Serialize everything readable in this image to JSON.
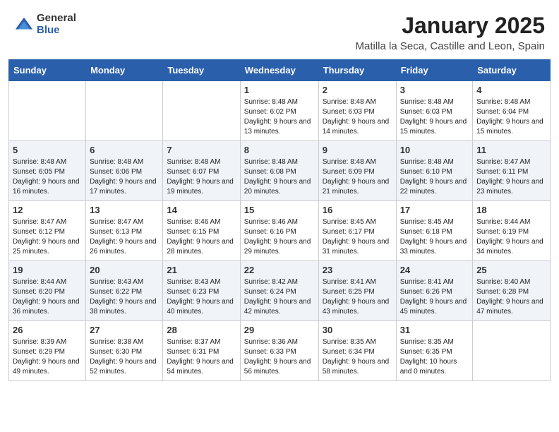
{
  "logo": {
    "general": "General",
    "blue": "Blue"
  },
  "title": "January 2025",
  "subtitle": "Matilla la Seca, Castille and Leon, Spain",
  "weekdays": [
    "Sunday",
    "Monday",
    "Tuesday",
    "Wednesday",
    "Thursday",
    "Friday",
    "Saturday"
  ],
  "weeks": [
    [
      {
        "day": "",
        "info": ""
      },
      {
        "day": "",
        "info": ""
      },
      {
        "day": "",
        "info": ""
      },
      {
        "day": "1",
        "info": "Sunrise: 8:48 AM\nSunset: 6:02 PM\nDaylight: 9 hours and 13 minutes."
      },
      {
        "day": "2",
        "info": "Sunrise: 8:48 AM\nSunset: 6:03 PM\nDaylight: 9 hours and 14 minutes."
      },
      {
        "day": "3",
        "info": "Sunrise: 8:48 AM\nSunset: 6:03 PM\nDaylight: 9 hours and 15 minutes."
      },
      {
        "day": "4",
        "info": "Sunrise: 8:48 AM\nSunset: 6:04 PM\nDaylight: 9 hours and 15 minutes."
      }
    ],
    [
      {
        "day": "5",
        "info": "Sunrise: 8:48 AM\nSunset: 6:05 PM\nDaylight: 9 hours and 16 minutes."
      },
      {
        "day": "6",
        "info": "Sunrise: 8:48 AM\nSunset: 6:06 PM\nDaylight: 9 hours and 17 minutes."
      },
      {
        "day": "7",
        "info": "Sunrise: 8:48 AM\nSunset: 6:07 PM\nDaylight: 9 hours and 19 minutes."
      },
      {
        "day": "8",
        "info": "Sunrise: 8:48 AM\nSunset: 6:08 PM\nDaylight: 9 hours and 20 minutes."
      },
      {
        "day": "9",
        "info": "Sunrise: 8:48 AM\nSunset: 6:09 PM\nDaylight: 9 hours and 21 minutes."
      },
      {
        "day": "10",
        "info": "Sunrise: 8:48 AM\nSunset: 6:10 PM\nDaylight: 9 hours and 22 minutes."
      },
      {
        "day": "11",
        "info": "Sunrise: 8:47 AM\nSunset: 6:11 PM\nDaylight: 9 hours and 23 minutes."
      }
    ],
    [
      {
        "day": "12",
        "info": "Sunrise: 8:47 AM\nSunset: 6:12 PM\nDaylight: 9 hours and 25 minutes."
      },
      {
        "day": "13",
        "info": "Sunrise: 8:47 AM\nSunset: 6:13 PM\nDaylight: 9 hours and 26 minutes."
      },
      {
        "day": "14",
        "info": "Sunrise: 8:46 AM\nSunset: 6:15 PM\nDaylight: 9 hours and 28 minutes."
      },
      {
        "day": "15",
        "info": "Sunrise: 8:46 AM\nSunset: 6:16 PM\nDaylight: 9 hours and 29 minutes."
      },
      {
        "day": "16",
        "info": "Sunrise: 8:45 AM\nSunset: 6:17 PM\nDaylight: 9 hours and 31 minutes."
      },
      {
        "day": "17",
        "info": "Sunrise: 8:45 AM\nSunset: 6:18 PM\nDaylight: 9 hours and 33 minutes."
      },
      {
        "day": "18",
        "info": "Sunrise: 8:44 AM\nSunset: 6:19 PM\nDaylight: 9 hours and 34 minutes."
      }
    ],
    [
      {
        "day": "19",
        "info": "Sunrise: 8:44 AM\nSunset: 6:20 PM\nDaylight: 9 hours and 36 minutes."
      },
      {
        "day": "20",
        "info": "Sunrise: 8:43 AM\nSunset: 6:22 PM\nDaylight: 9 hours and 38 minutes."
      },
      {
        "day": "21",
        "info": "Sunrise: 8:43 AM\nSunset: 6:23 PM\nDaylight: 9 hours and 40 minutes."
      },
      {
        "day": "22",
        "info": "Sunrise: 8:42 AM\nSunset: 6:24 PM\nDaylight: 9 hours and 42 minutes."
      },
      {
        "day": "23",
        "info": "Sunrise: 8:41 AM\nSunset: 6:25 PM\nDaylight: 9 hours and 43 minutes."
      },
      {
        "day": "24",
        "info": "Sunrise: 8:41 AM\nSunset: 6:26 PM\nDaylight: 9 hours and 45 minutes."
      },
      {
        "day": "25",
        "info": "Sunrise: 8:40 AM\nSunset: 6:28 PM\nDaylight: 9 hours and 47 minutes."
      }
    ],
    [
      {
        "day": "26",
        "info": "Sunrise: 8:39 AM\nSunset: 6:29 PM\nDaylight: 9 hours and 49 minutes."
      },
      {
        "day": "27",
        "info": "Sunrise: 8:38 AM\nSunset: 6:30 PM\nDaylight: 9 hours and 52 minutes."
      },
      {
        "day": "28",
        "info": "Sunrise: 8:37 AM\nSunset: 6:31 PM\nDaylight: 9 hours and 54 minutes."
      },
      {
        "day": "29",
        "info": "Sunrise: 8:36 AM\nSunset: 6:33 PM\nDaylight: 9 hours and 56 minutes."
      },
      {
        "day": "30",
        "info": "Sunrise: 8:35 AM\nSunset: 6:34 PM\nDaylight: 9 hours and 58 minutes."
      },
      {
        "day": "31",
        "info": "Sunrise: 8:35 AM\nSunset: 6:35 PM\nDaylight: 10 hours and 0 minutes."
      },
      {
        "day": "",
        "info": ""
      }
    ]
  ]
}
